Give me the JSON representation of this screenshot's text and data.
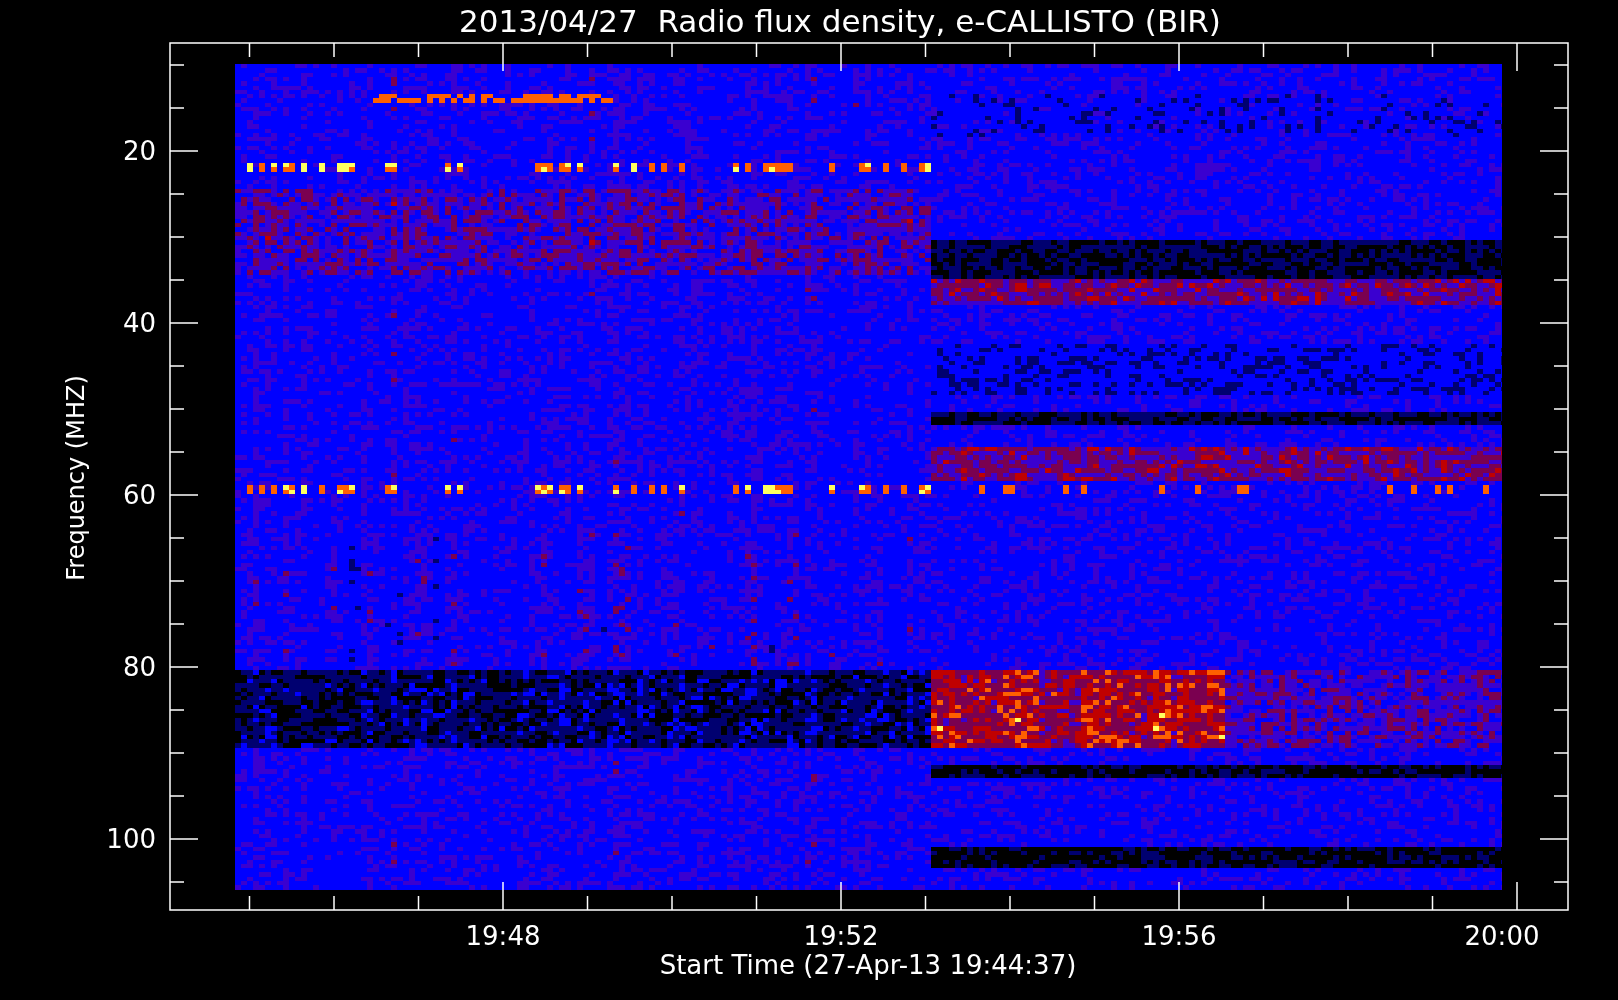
{
  "title": "2013/04/27  Radio flux density, e-CALLISTO (BIR)",
  "ylabel": "Frequency (MHZ)",
  "xlabel": "Start Time (27-Apr-13 19:44:37)",
  "y_tick_labels": [
    "20",
    "40",
    "60",
    "80",
    "100"
  ],
  "x_tick_labels": [
    "19:48",
    "19:52",
    "19:56",
    "20:00"
  ]
}
